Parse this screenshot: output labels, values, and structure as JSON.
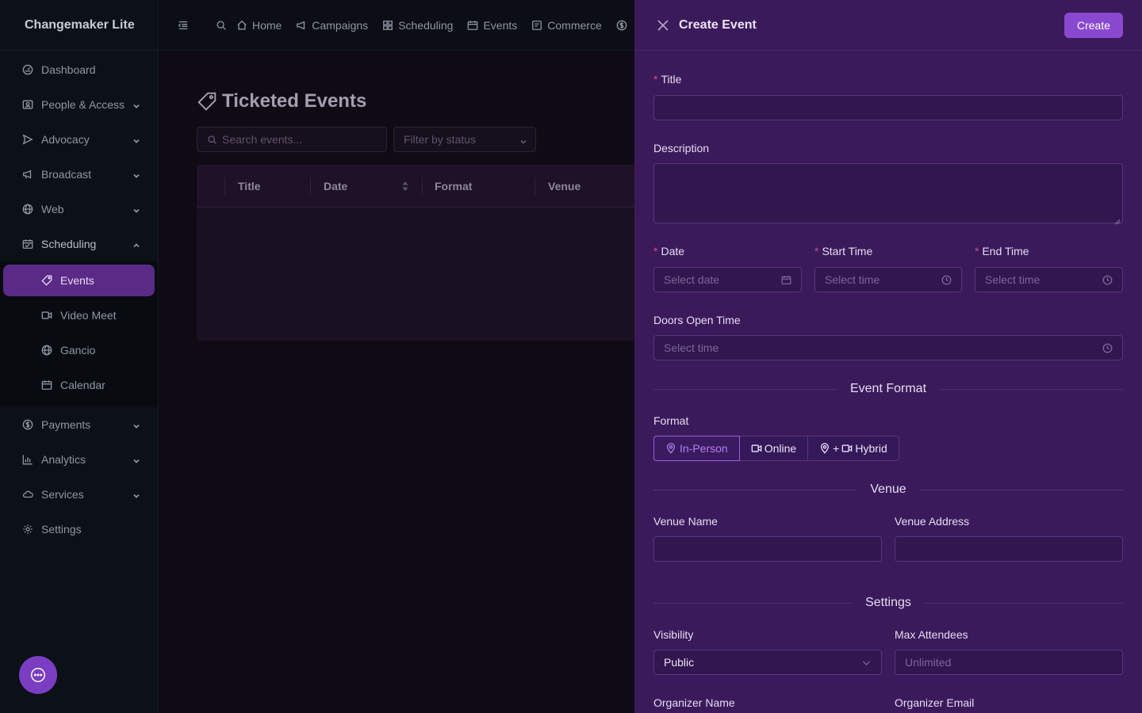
{
  "app": {
    "brand": "Changemaker Lite"
  },
  "sidebar": {
    "items": [
      {
        "label": "Dashboard",
        "icon": "dashboard-icon"
      },
      {
        "label": "People & Access",
        "icon": "people-icon"
      },
      {
        "label": "Advocacy",
        "icon": "send-icon"
      },
      {
        "label": "Broadcast",
        "icon": "megaphone-icon"
      },
      {
        "label": "Web",
        "icon": "globe-icon"
      },
      {
        "label": "Scheduling",
        "icon": "calendar-icon"
      },
      {
        "label": "Payments",
        "icon": "dollar-icon"
      },
      {
        "label": "Analytics",
        "icon": "bar-chart-icon"
      },
      {
        "label": "Services",
        "icon": "cloud-icon"
      },
      {
        "label": "Settings",
        "icon": "gear-icon"
      }
    ],
    "scheduling_sub": [
      {
        "label": "Events",
        "icon": "tag-icon"
      },
      {
        "label": "Video Meet",
        "icon": "video-icon"
      },
      {
        "label": "Gancio",
        "icon": "globe-icon"
      },
      {
        "label": "Calendar",
        "icon": "calendar-icon"
      }
    ]
  },
  "topnav": {
    "items": [
      {
        "label": "Home"
      },
      {
        "label": "Campaigns"
      },
      {
        "label": "Scheduling"
      },
      {
        "label": "Events"
      },
      {
        "label": "Commerce"
      }
    ]
  },
  "main": {
    "title": "Ticketed Events",
    "search_placeholder": "Search events...",
    "filter_placeholder": "Filter by status",
    "columns": [
      "Title",
      "Date",
      "Format",
      "Venue"
    ]
  },
  "drawer": {
    "title": "Create Event",
    "create_label": "Create",
    "title_label": "Title",
    "description_label": "Description",
    "date_label": "Date",
    "date_placeholder": "Select date",
    "start_label": "Start Time",
    "end_label": "End Time",
    "time_placeholder": "Select time",
    "doors_label": "Doors Open Time",
    "section_format": "Event Format",
    "format_label": "Format",
    "format_options": [
      "In-Person",
      "Online",
      "Hybrid"
    ],
    "format_plus": "+",
    "section_venue": "Venue",
    "venue_name_label": "Venue Name",
    "venue_address_label": "Venue Address",
    "section_settings": "Settings",
    "visibility_label": "Visibility",
    "visibility_value": "Public",
    "max_label": "Max Attendees",
    "max_placeholder": "Unlimited",
    "organizer_name_label": "Organizer Name",
    "organizer_email_label": "Organizer Email"
  }
}
